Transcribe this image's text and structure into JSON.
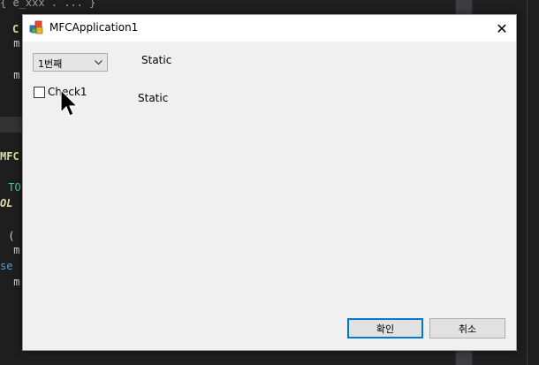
{
  "editor": {
    "lines": [
      {
        "text": "{ e_xxx . ... }",
        "cls": "c-gray"
      },
      {
        "text": "C",
        "cls": "c-yellow"
      },
      {
        "text": " m",
        "cls": "c-white"
      },
      {
        "text": " m",
        "cls": "c-white"
      },
      {
        "text": "MFC",
        "cls": "c-yellow"
      },
      {
        "text": " TO",
        "cls": "c-green"
      },
      {
        "text": "OL",
        "cls": "c-yi"
      },
      {
        "text": " (",
        "cls": "c-white"
      },
      {
        "text": " m",
        "cls": "c-white"
      },
      {
        "text": "se",
        "cls": "c-blue"
      },
      {
        "text": " m",
        "cls": "c-white"
      }
    ]
  },
  "window": {
    "title": "MFCApplication1",
    "close_glyph": "✕"
  },
  "dialog": {
    "combo": {
      "value": "1번째"
    },
    "static1": "Static",
    "static2": "Static",
    "checkbox": {
      "label": "Check1",
      "checked": false
    },
    "ok_label": "확인",
    "cancel_label": "취소"
  },
  "colors": {
    "accent": "#0078d7",
    "dialog_bg": "#f0f0f0",
    "editor_bg": "#1e1e1e"
  }
}
